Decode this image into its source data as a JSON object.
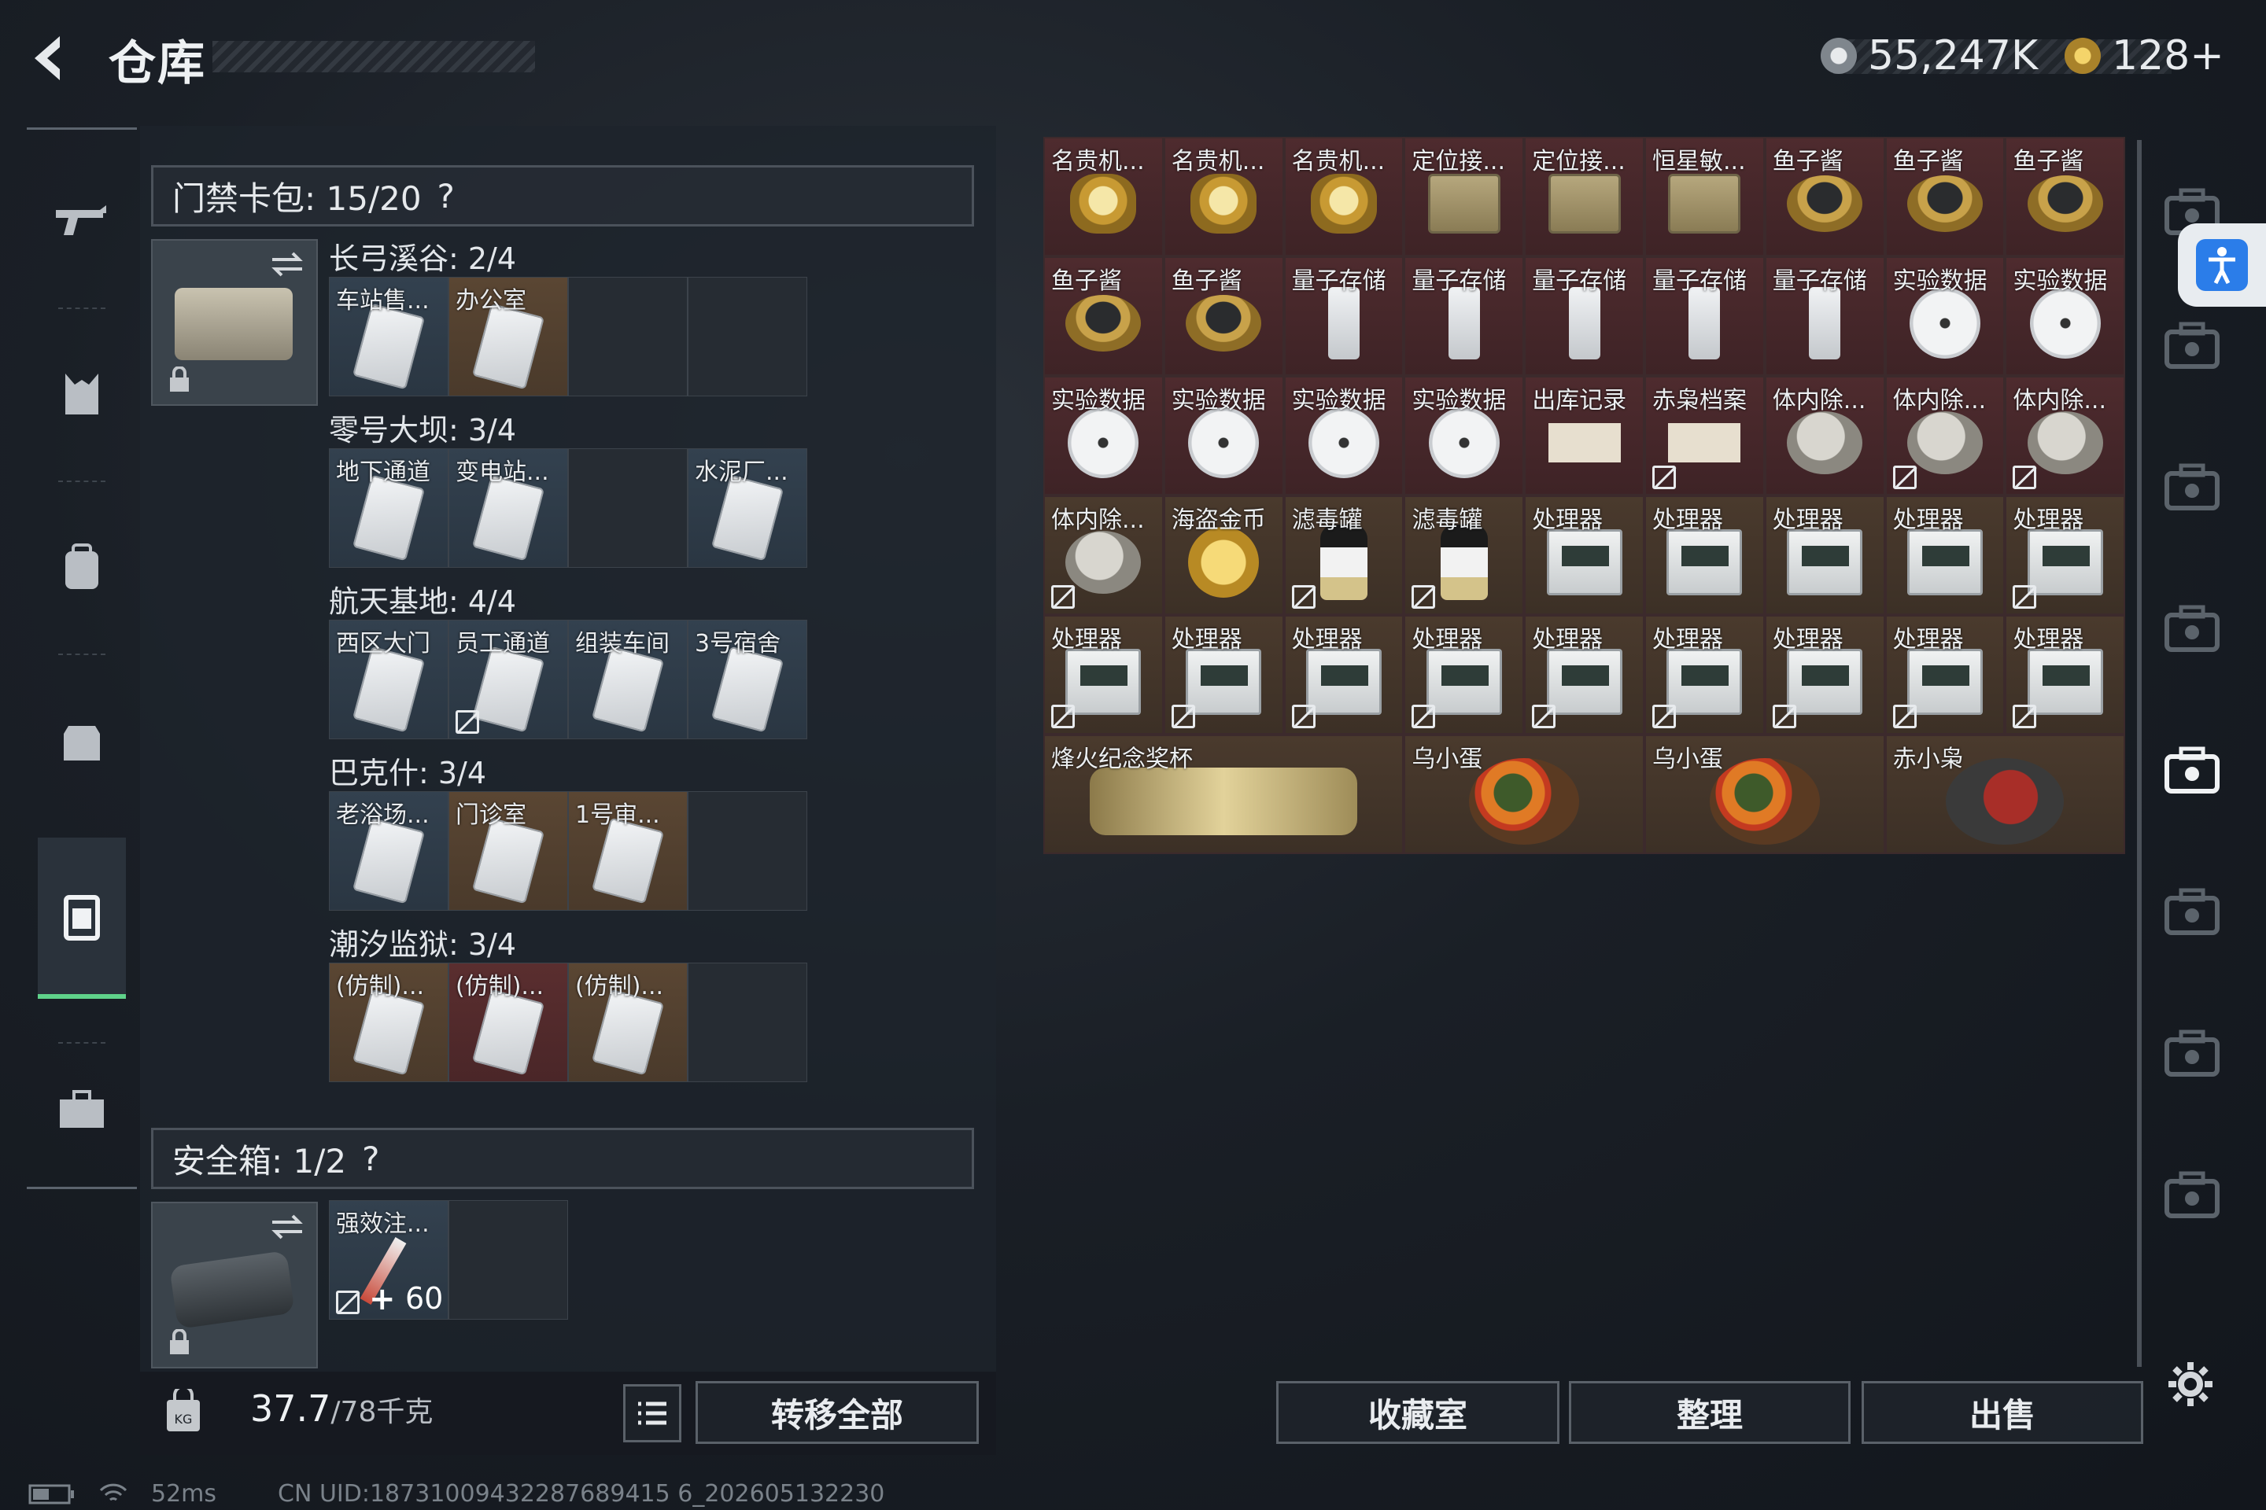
{
  "header": {
    "title": "仓库",
    "currency1": "55,247K",
    "currency2": "128+"
  },
  "colors": {
    "accent_green": "#5fd28a",
    "item_red": "#4e2b2e",
    "item_brown": "#4a3a2d",
    "card_blue": "#33414f"
  },
  "left_nav": [
    {
      "icon": "rifle-icon"
    },
    {
      "icon": "armor-vest-icon"
    },
    {
      "icon": "backpack-icon"
    },
    {
      "icon": "chest-rig-icon"
    },
    {
      "icon": "card-pack-icon",
      "active": true
    },
    {
      "icon": "toolbox-icon"
    }
  ],
  "keycard": {
    "header": "门禁卡包:  15/20",
    "help": "?",
    "groups": [
      {
        "title": "长弓溪谷: 2/4",
        "cards": [
          {
            "label": "车站售...",
            "color": "blue"
          },
          {
            "label": "办公室",
            "color": "brown"
          },
          {
            "label": "",
            "color": "empty"
          },
          {
            "label": "",
            "color": "empty"
          }
        ]
      },
      {
        "title": "零号大坝: 3/4",
        "cards": [
          {
            "label": "地下通道",
            "color": "blue"
          },
          {
            "label": "变电站...",
            "color": "blue"
          },
          {
            "label": "",
            "color": "empty"
          },
          {
            "label": "水泥厂...",
            "color": "blue"
          }
        ]
      },
      {
        "title": "航天基地: 4/4",
        "cards": [
          {
            "label": "西区大门",
            "color": "blue"
          },
          {
            "label": "员工通道",
            "color": "blue",
            "flag": true
          },
          {
            "label": "组装车间",
            "color": "blue"
          },
          {
            "label": "3号宿舍",
            "color": "blue"
          }
        ]
      },
      {
        "title": "巴克什: 3/4",
        "cards": [
          {
            "label": "老浴场...",
            "color": "blue"
          },
          {
            "label": "门诊室",
            "color": "brown"
          },
          {
            "label": "1号审...",
            "color": "brown"
          },
          {
            "label": "",
            "color": "empty"
          }
        ]
      },
      {
        "title": "潮汐监狱: 3/4",
        "cards": [
          {
            "label": "(仿制)...",
            "color": "brown"
          },
          {
            "label": "(仿制)...",
            "color": "red"
          },
          {
            "label": "(仿制)...",
            "color": "brown"
          },
          {
            "label": "",
            "color": "empty"
          }
        ]
      }
    ]
  },
  "safebox": {
    "header": "安全箱:  1/2",
    "help": "?",
    "item_label": "强效注...",
    "item_count": "60",
    "item_badge": "+"
  },
  "weight": {
    "current": "37.7",
    "max": "/78千克"
  },
  "buttons": {
    "transfer_all": "转移全部",
    "collection": "收藏室",
    "organize": "整理",
    "sell": "出售"
  },
  "status": {
    "ping": "52ms",
    "uid": "CN UID:18731009432287689415 6_202605132230"
  },
  "items": [
    {
      "label": "名贵机...",
      "obj": "watch",
      "c": "red"
    },
    {
      "label": "名贵机...",
      "obj": "watch",
      "c": "red"
    },
    {
      "label": "名贵机...",
      "obj": "watch",
      "c": "red"
    },
    {
      "label": "定位接...",
      "obj": "device",
      "c": "red"
    },
    {
      "label": "定位接...",
      "obj": "device",
      "c": "red"
    },
    {
      "label": "恒星敏...",
      "obj": "device",
      "c": "red"
    },
    {
      "label": "鱼子酱",
      "obj": "tin",
      "c": "red"
    },
    {
      "label": "鱼子酱",
      "obj": "tin",
      "c": "red"
    },
    {
      "label": "鱼子酱",
      "obj": "tin",
      "c": "red"
    },
    {
      "label": "鱼子酱",
      "obj": "tin",
      "c": "red"
    },
    {
      "label": "鱼子酱",
      "obj": "tin",
      "c": "red"
    },
    {
      "label": "量子存储",
      "obj": "usb",
      "c": "red"
    },
    {
      "label": "量子存储",
      "obj": "usb",
      "c": "red"
    },
    {
      "label": "量子存储",
      "obj": "usb",
      "c": "red"
    },
    {
      "label": "量子存储",
      "obj": "usb",
      "c": "red"
    },
    {
      "label": "量子存储",
      "obj": "usb",
      "c": "red"
    },
    {
      "label": "实验数据",
      "obj": "disc",
      "c": "red"
    },
    {
      "label": "实验数据",
      "obj": "disc",
      "c": "red"
    },
    {
      "label": "实验数据",
      "obj": "disc",
      "c": "red"
    },
    {
      "label": "实验数据",
      "obj": "disc",
      "c": "red"
    },
    {
      "label": "实验数据",
      "obj": "disc",
      "c": "red"
    },
    {
      "label": "实验数据",
      "obj": "disc",
      "c": "red"
    },
    {
      "label": "出库记录",
      "obj": "paper",
      "c": "red"
    },
    {
      "label": "赤枭档案",
      "obj": "paper",
      "c": "red",
      "flag": true
    },
    {
      "label": "体内除...",
      "obj": "shell",
      "c": "red"
    },
    {
      "label": "体内除...",
      "obj": "shell",
      "c": "red",
      "flag": true
    },
    {
      "label": "体内除...",
      "obj": "shell",
      "c": "red",
      "flag": true
    },
    {
      "label": "体内除...",
      "obj": "shell",
      "c": "brown",
      "flag": true
    },
    {
      "label": "海盗金币",
      "obj": "gold",
      "c": "brown"
    },
    {
      "label": "滤毒罐",
      "obj": "mask",
      "c": "brown",
      "flag": true
    },
    {
      "label": "滤毒罐",
      "obj": "mask",
      "c": "brown",
      "flag": true
    },
    {
      "label": "处理器",
      "obj": "cpu",
      "c": "brown"
    },
    {
      "label": "处理器",
      "obj": "cpu",
      "c": "brown"
    },
    {
      "label": "处理器",
      "obj": "cpu",
      "c": "brown"
    },
    {
      "label": "处理器",
      "obj": "cpu",
      "c": "brown"
    },
    {
      "label": "处理器",
      "obj": "cpu",
      "c": "brown",
      "flag": true
    },
    {
      "label": "处理器",
      "obj": "cpu",
      "c": "brown",
      "flag": true
    },
    {
      "label": "处理器",
      "obj": "cpu",
      "c": "brown",
      "flag": true
    },
    {
      "label": "处理器",
      "obj": "cpu",
      "c": "brown",
      "flag": true
    },
    {
      "label": "处理器",
      "obj": "cpu",
      "c": "brown",
      "flag": true
    },
    {
      "label": "处理器",
      "obj": "cpu",
      "c": "brown",
      "flag": true
    },
    {
      "label": "处理器",
      "obj": "cpu",
      "c": "brown",
      "flag": true
    },
    {
      "label": "处理器",
      "obj": "cpu",
      "c": "brown",
      "flag": true
    },
    {
      "label": "处理器",
      "obj": "cpu",
      "c": "brown",
      "flag": true
    },
    {
      "label": "处理器",
      "obj": "cpu",
      "c": "brown",
      "flag": true
    }
  ],
  "large_items": [
    {
      "label": "烽火纪念奖杯",
      "obj": "cup"
    },
    {
      "label": "乌小蛋",
      "obj": "egg"
    },
    {
      "label": "乌小蛋",
      "obj": "egg"
    },
    {
      "label": "赤小枭",
      "obj": "owl"
    }
  ],
  "right_nav": [
    "case-icon-1",
    "case-icon-iv-a",
    "case-icon-iv-b",
    "case-icon-iv-c",
    "case-icon-iv-d",
    "case-icon-iv-e",
    "case-icon-iii-a",
    "case-icon-iii-b"
  ]
}
